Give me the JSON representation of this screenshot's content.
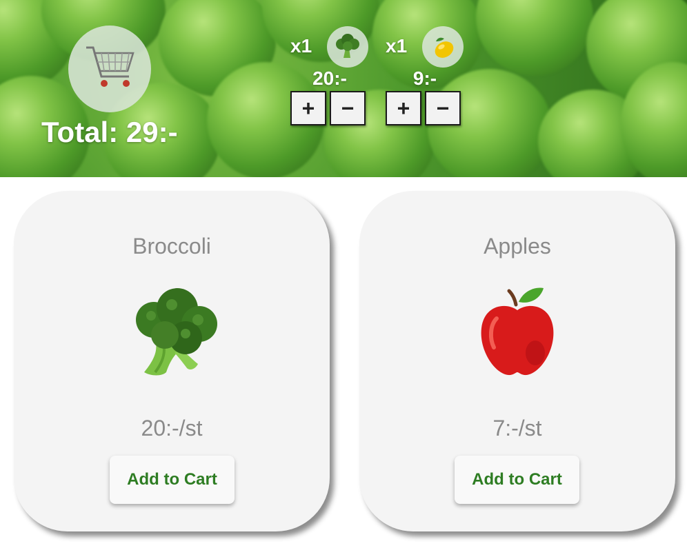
{
  "header": {
    "total_label": "Total: 29:-"
  },
  "cart_items": [
    {
      "qty": "x1",
      "price": "20:-",
      "icon": "broccoli-icon",
      "plus": "+",
      "minus": "−"
    },
    {
      "qty": "x1",
      "price": "9:-",
      "icon": "lemon-icon",
      "plus": "+",
      "minus": "−"
    }
  ],
  "products": [
    {
      "name": "Broccoli",
      "icon": "broccoli-icon",
      "price": "20:-/st",
      "button": "Add to Cart"
    },
    {
      "name": "Apples",
      "icon": "apple-icon",
      "price": "7:-/st",
      "button": "Add to Cart"
    }
  ],
  "colors": {
    "header_green": "#4f9a2d",
    "button_text_green": "#2e7d23",
    "card_background": "#f4f4f4"
  }
}
